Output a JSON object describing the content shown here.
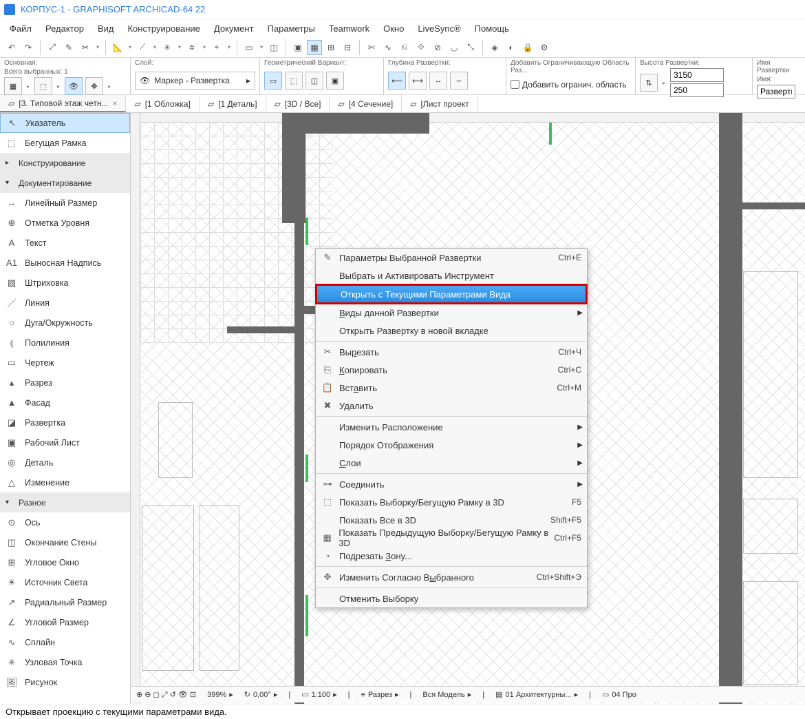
{
  "title": "КОРПУС-1 - GRAPHISOFT ARCHICAD-64 22",
  "menu": [
    "Файл",
    "Редактор",
    "Вид",
    "Конструирование",
    "Документ",
    "Параметры",
    "Teamwork",
    "Окно",
    "LiveSync®",
    "Помощь"
  ],
  "infobox": {
    "main_lbl": "Основная:",
    "selected_lbl": "Всего выбранных: 1",
    "layer_lbl": "Слой:",
    "layer_val": "Маркер - Развертка",
    "geom_lbl": "Геометрический Вариант:",
    "depth_lbl": "Глубина Развертки:",
    "add_bound_lbl": "Добавить Ограничивающую Область Раз...",
    "add_bound_check": "Добавить огранич. область",
    "height_lbl": "Высота Развертки:",
    "height_top": "3150",
    "height_bot": "250",
    "name_lbl": "Имя Развертки",
    "name_sub": "Имя:",
    "name_val": "Развертк"
  },
  "tabs": [
    {
      "label": "[3. Типовой этаж четн...",
      "close": "×",
      "active": true
    },
    {
      "label": "[1 Обложка]"
    },
    {
      "label": "[1 Деталь]"
    },
    {
      "label": "[3D / Все]"
    },
    {
      "label": "[4 Сечение]"
    },
    {
      "label": "[Лист проект"
    }
  ],
  "toolbox": [
    {
      "t": "tool",
      "label": "Указатель",
      "sel": true,
      "icon": "arrow"
    },
    {
      "t": "tool",
      "label": "Бегущая Рамка",
      "icon": "marquee"
    },
    {
      "t": "group",
      "label": "Конструирование",
      "open": false
    },
    {
      "t": "group",
      "label": "Документирование",
      "open": true
    },
    {
      "t": "tool",
      "label": "Линейный Размер",
      "icon": "dim"
    },
    {
      "t": "tool",
      "label": "Отметка Уровня",
      "icon": "level"
    },
    {
      "t": "tool",
      "label": "Текст",
      "icon": "text"
    },
    {
      "t": "tool",
      "label": "Выносная Надпись",
      "icon": "label"
    },
    {
      "t": "tool",
      "label": "Штриховка",
      "icon": "fill"
    },
    {
      "t": "tool",
      "label": "Линия",
      "icon": "line"
    },
    {
      "t": "tool",
      "label": "Дуга/Окружность",
      "icon": "circle"
    },
    {
      "t": "tool",
      "label": "Полилиния",
      "icon": "poly"
    },
    {
      "t": "tool",
      "label": "Чертеж",
      "icon": "drawing"
    },
    {
      "t": "tool",
      "label": "Разрез",
      "icon": "section"
    },
    {
      "t": "tool",
      "label": "Фасад",
      "icon": "elev"
    },
    {
      "t": "tool",
      "label": "Развертка",
      "icon": "interior"
    },
    {
      "t": "tool",
      "label": "Рабочий Лист",
      "icon": "worksheet"
    },
    {
      "t": "tool",
      "label": "Деталь",
      "icon": "detail"
    },
    {
      "t": "tool",
      "label": "Изменение",
      "icon": "change"
    },
    {
      "t": "group",
      "label": "Разное",
      "open": true
    },
    {
      "t": "tool",
      "label": "Ось",
      "icon": "axis"
    },
    {
      "t": "tool",
      "label": "Окончание Стены",
      "icon": "wallend"
    },
    {
      "t": "tool",
      "label": "Угловое Окно",
      "icon": "cornerwin"
    },
    {
      "t": "tool",
      "label": "Источник Света",
      "icon": "lamp"
    },
    {
      "t": "tool",
      "label": "Радиальный Размер",
      "icon": "raddim"
    },
    {
      "t": "tool",
      "label": "Угловой Размер",
      "icon": "angdim"
    },
    {
      "t": "tool",
      "label": "Сплайн",
      "icon": "spline"
    },
    {
      "t": "tool",
      "label": "Узловая Точка",
      "icon": "hotspot"
    },
    {
      "t": "tool",
      "label": "Рисунок",
      "icon": "figure"
    }
  ],
  "context": [
    {
      "t": "item",
      "label": "Параметры Выбранной Развертки",
      "short": "Ctrl+E",
      "icon": "props"
    },
    {
      "t": "item",
      "label": "Выбрать и Активировать Инструмент"
    },
    {
      "t": "hl",
      "label": "Открыть с Текущими Параметрами Вида"
    },
    {
      "t": "sub",
      "label": "Виды данной Развертки",
      "ul": 0
    },
    {
      "t": "item",
      "label": "Открыть Развертку в новой вкладке"
    },
    {
      "t": "sep"
    },
    {
      "t": "item",
      "label": "Вырезать",
      "short": "Ctrl+Ч",
      "ul": 2,
      "icon": "cut"
    },
    {
      "t": "item",
      "label": "Копировать",
      "short": "Ctrl+С",
      "ul": 0,
      "icon": "copy"
    },
    {
      "t": "item",
      "label": "Вставить",
      "short": "Ctrl+М",
      "ul": 3,
      "icon": "paste"
    },
    {
      "t": "item",
      "label": "Удалить",
      "icon": "delete"
    },
    {
      "t": "sep"
    },
    {
      "t": "sub",
      "label": "Изменить Расположение"
    },
    {
      "t": "sub",
      "label": "Порядок Отображения"
    },
    {
      "t": "sub",
      "label": "Слои",
      "ul": 0
    },
    {
      "t": "sep"
    },
    {
      "t": "sub",
      "label": "Соединить",
      "icon": "connect"
    },
    {
      "t": "item",
      "label": "Показать Выборку/Бегущую Рамку в 3D",
      "short": "F5",
      "icon": "sel3d"
    },
    {
      "t": "item",
      "label": "Показать Все в 3D",
      "short": "Shift+F5"
    },
    {
      "t": "item",
      "label": "Показать Предыдущую Выборку/Бегущую Рамку в 3D",
      "short": "Ctrl+F5",
      "icon": "prev3d"
    },
    {
      "t": "item",
      "label": "Подрезать Зону...",
      "ul": 10,
      "icon": "zone"
    },
    {
      "t": "sep"
    },
    {
      "t": "item",
      "label": "Изменить Согласно Выбранного",
      "short": "Ctrl+Shift+Э",
      "ul": 19,
      "icon": "pickup"
    },
    {
      "t": "sep"
    },
    {
      "t": "item",
      "label": "Отменить Выборку"
    }
  ],
  "status": {
    "zoom_pct": "399%",
    "angle": "0,00°",
    "scale": "1:100",
    "section": "Разрез",
    "model": "Вся Модель",
    "layers": "01 Архитектурны...",
    "page": "04 Про"
  },
  "bottom_hint": "Открывает проекцию с текущими параметрами вида."
}
